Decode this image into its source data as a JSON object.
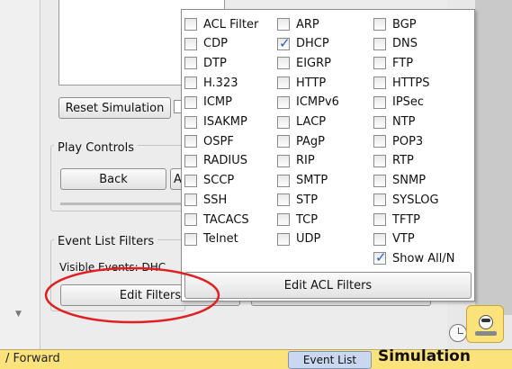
{
  "simulation_panel": {
    "reset_simulation_label": "Reset Simulation",
    "play_controls_label": "Play Controls",
    "back_label": "Back",
    "auto_capture_label_partial": "A",
    "event_list_filters_label": "Event List Filters",
    "visible_events_text": "Visible Events: DHC",
    "edit_filters_label": "Edit Filters"
  },
  "filter_popup": {
    "columns": [
      [
        {
          "label": "ACL Filter",
          "checked": false
        },
        {
          "label": "CDP",
          "checked": false
        },
        {
          "label": "DTP",
          "checked": false
        },
        {
          "label": "H.323",
          "checked": false
        },
        {
          "label": "ICMP",
          "checked": false
        },
        {
          "label": "ISAKMP",
          "checked": false
        },
        {
          "label": "OSPF",
          "checked": false
        },
        {
          "label": "RADIUS",
          "checked": false
        },
        {
          "label": "SCCP",
          "checked": false
        },
        {
          "label": "SSH",
          "checked": false
        },
        {
          "label": "TACACS",
          "checked": false
        },
        {
          "label": "Telnet",
          "checked": false
        }
      ],
      [
        {
          "label": "ARP",
          "checked": false
        },
        {
          "label": "DHCP",
          "checked": true
        },
        {
          "label": "EIGRP",
          "checked": false
        },
        {
          "label": "HTTP",
          "checked": false
        },
        {
          "label": "ICMPv6",
          "checked": false
        },
        {
          "label": "LACP",
          "checked": false
        },
        {
          "label": "PAgP",
          "checked": false
        },
        {
          "label": "RIP",
          "checked": false
        },
        {
          "label": "SMTP",
          "checked": false
        },
        {
          "label": "STP",
          "checked": false
        },
        {
          "label": "TCP",
          "checked": false
        },
        {
          "label": "UDP",
          "checked": false
        }
      ],
      [
        {
          "label": "BGP",
          "checked": false
        },
        {
          "label": "DNS",
          "checked": false
        },
        {
          "label": "FTP",
          "checked": false
        },
        {
          "label": "HTTPS",
          "checked": false
        },
        {
          "label": "IPSec",
          "checked": false
        },
        {
          "label": "NTP",
          "checked": false
        },
        {
          "label": "POP3",
          "checked": false
        },
        {
          "label": "RTP",
          "checked": false
        },
        {
          "label": "SNMP",
          "checked": false
        },
        {
          "label": "SYSLOG",
          "checked": false
        },
        {
          "label": "TFTP",
          "checked": false
        },
        {
          "label": "VTP",
          "checked": false
        }
      ]
    ],
    "show_all": {
      "label": "Show All/N",
      "checked": true
    },
    "edit_acl_filters_label": "Edit ACL Filters"
  },
  "bottom_bar": {
    "forward_text": "/ Forward",
    "event_list_tab_label": "Event List",
    "mode_label": "Simulation"
  },
  "colors": {
    "bottom_bar": "#fbe27a",
    "check_mark": "#2a5fbf",
    "annotation_ellipse": "#e02020",
    "event_list_tab": "#c9d8ee"
  },
  "icons": {
    "check": "✓",
    "scroll_down": "▼"
  }
}
